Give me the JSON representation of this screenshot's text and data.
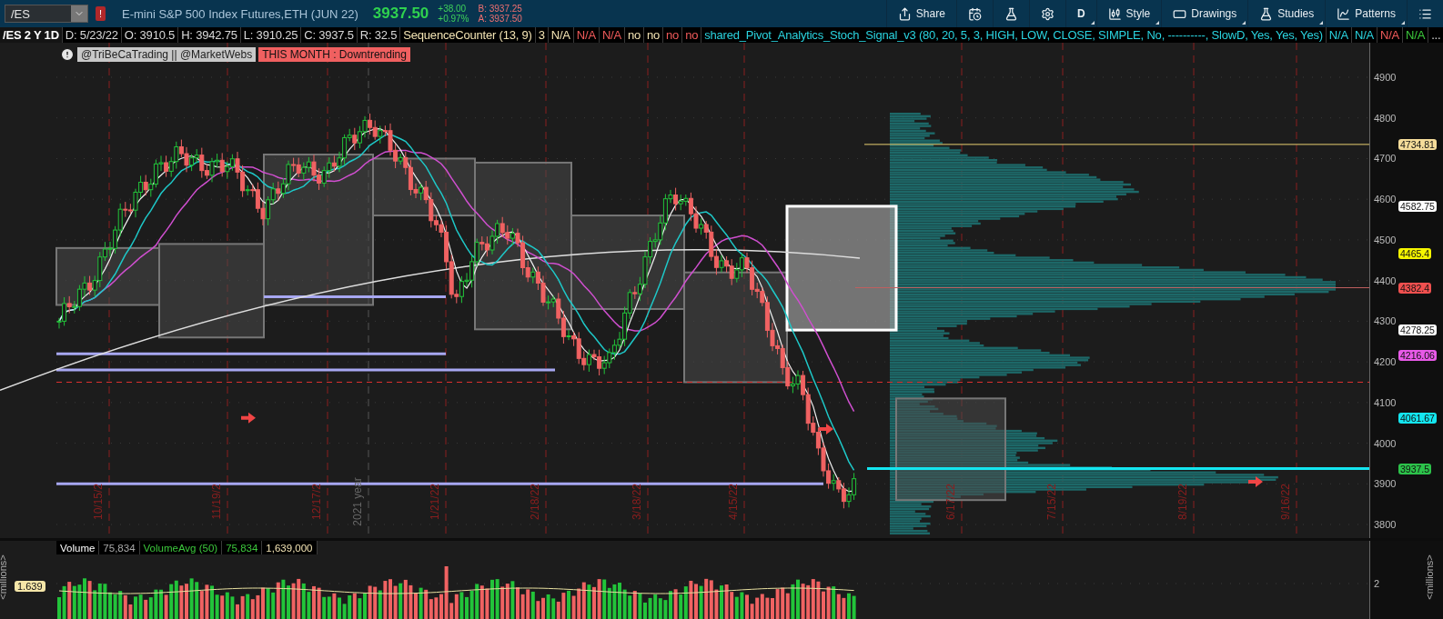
{
  "symbol": {
    "value": "/ES",
    "alert": "!"
  },
  "instrument": {
    "description": "E-mini S&P 500 Index Futures,ETH (JUN 22)",
    "last": "3937.50",
    "change": "+38.00",
    "change_pct": "+0.97%",
    "bid": "B: 3937.25",
    "ask": "A: 3937.50"
  },
  "toolbar": [
    {
      "kind": "button",
      "label": "Share",
      "menu": false
    },
    {
      "kind": "icon",
      "menu": false
    },
    {
      "kind": "icon",
      "menu": false
    },
    {
      "kind": "icon",
      "menu": false
    },
    {
      "kind": "button",
      "label": "D",
      "menu": true
    },
    {
      "kind": "button",
      "label": "Style",
      "menu": true
    },
    {
      "kind": "button",
      "label": "Drawings",
      "menu": true
    },
    {
      "kind": "button",
      "label": "Studies",
      "menu": true
    },
    {
      "kind": "button",
      "label": "Patterns",
      "menu": true
    },
    {
      "kind": "icon",
      "menu": false
    }
  ],
  "info_row": [
    {
      "kind": "title",
      "text": "/ES 2 Y 1D",
      "color": "#ffffff"
    },
    {
      "kind": "cell",
      "text": "D: 5/23/22",
      "color": "#d8d8d8"
    },
    {
      "kind": "cell",
      "text": "O: 3910.5",
      "color": "#d8d8d8"
    },
    {
      "kind": "cell",
      "text": "H: 3942.75",
      "color": "#d8d8d8"
    },
    {
      "kind": "cell",
      "text": "L: 3910.25",
      "color": "#d8d8d8"
    },
    {
      "kind": "cell",
      "text": "C: 3937.5",
      "color": "#d8d8d8"
    },
    {
      "kind": "cell",
      "text": "R: 32.5",
      "color": "#d8d8d8"
    },
    {
      "kind": "cell",
      "text": "SequenceCounter (13, 9)",
      "color": "#f2e3b3"
    },
    {
      "kind": "cell",
      "text": "3",
      "color": "#f2e3b3"
    },
    {
      "kind": "cell",
      "text": "N/A",
      "color": "#f2e3b3"
    },
    {
      "kind": "cell",
      "text": "N/A",
      "color": "#f05a5a"
    },
    {
      "kind": "cell",
      "text": "N/A",
      "color": "#f05a5a"
    },
    {
      "kind": "cell",
      "text": "no",
      "color": "#f2e3b3"
    },
    {
      "kind": "cell",
      "text": "no",
      "color": "#f2e3b3"
    },
    {
      "kind": "cell",
      "text": "no",
      "color": "#f05a5a"
    },
    {
      "kind": "cell",
      "text": "no",
      "color": "#f05a5a"
    },
    {
      "kind": "cell",
      "text": "shared_Pivot_Analytics_Stoch_Signal_v3 (80, 20, 5, 3, HIGH, LOW, CLOSE, SIMPLE, No, ----------, SlowD, Yes, Yes, Yes)",
      "color": "#2ad4e0"
    },
    {
      "kind": "cell",
      "text": "N/A",
      "color": "#2ad4e0"
    },
    {
      "kind": "cell",
      "text": "N/A",
      "color": "#2ad4e0"
    },
    {
      "kind": "cell",
      "text": "N/A",
      "color": "#f05a5a"
    },
    {
      "kind": "cell",
      "text": "N/A",
      "color": "#3cc83c"
    },
    {
      "kind": "cell",
      "text": "..."
    }
  ],
  "labels": [
    {
      "kind": "alert"
    },
    {
      "kind": "label",
      "text": "@TriBeCaTrading || @MarketWebs"
    },
    {
      "kind": "warning",
      "text": "THIS MONTH : Downtrending"
    }
  ],
  "price_axis": [
    "4900",
    "4800",
    "4700",
    "4600",
    "4500",
    "4400",
    "4300",
    "4200",
    "4100",
    "4000",
    "3900",
    "3800"
  ],
  "price_tags": [
    {
      "text": "4734.81",
      "color": "#f5dc9a"
    },
    {
      "text": "4582.75",
      "color": "#ffffff"
    },
    {
      "text": "4465.4",
      "color": "#f5f500"
    },
    {
      "text": "4382.4",
      "color": "#f0504f"
    },
    {
      "text": "4278.25",
      "color": "#ffffff"
    },
    {
      "text": "4216.06",
      "color": "#e85ae8"
    },
    {
      "text": "4061.67",
      "color": "#14e6f0"
    },
    {
      "text": "3937.5",
      "color": "#2cc24a"
    }
  ],
  "date_labels": [
    {
      "kind": "month",
      "text": "10/15/2"
    },
    {
      "kind": "month",
      "text": "11/19/2"
    },
    {
      "kind": "month",
      "text": "12/17/2"
    },
    {
      "kind": "year",
      "text": "2021 year"
    },
    {
      "kind": "month",
      "text": "1/21/22"
    },
    {
      "kind": "month",
      "text": "2/18/22"
    },
    {
      "kind": "month",
      "text": "3/18/22"
    },
    {
      "kind": "month",
      "text": "4/15/22"
    },
    {
      "kind": "month",
      "text": "6/17/22"
    },
    {
      "kind": "month",
      "text": "7/15/22"
    },
    {
      "kind": "month",
      "text": "8/19/22"
    },
    {
      "kind": "month",
      "text": "9/16/22"
    }
  ],
  "volume": {
    "title": "Volume",
    "value": "75,834",
    "avg_title": "VolumeAvg (50)",
    "avg_value": "75,834",
    "avg_total": "1,639,000",
    "left_unit": "<millions>",
    "right_unit": "<millions>",
    "tag": "1.639",
    "ticks": [
      "2"
    ]
  }
}
